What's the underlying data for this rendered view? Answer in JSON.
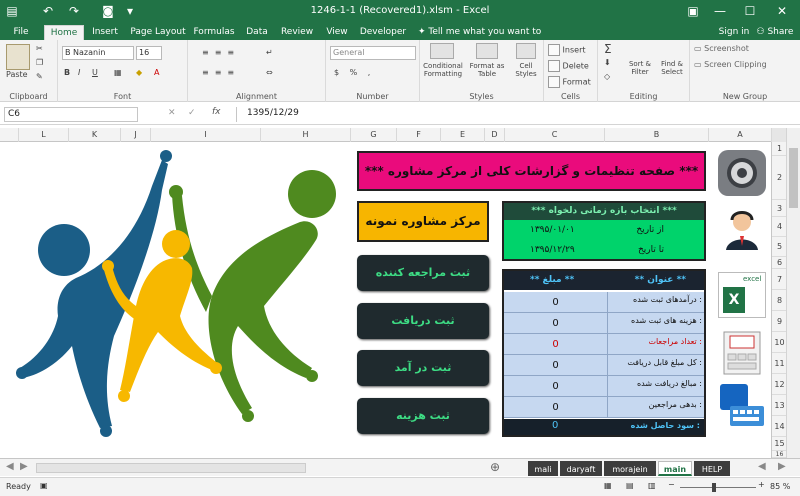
{
  "titlebar": {
    "title": "1246-1-1 (Recovered1).xlsm - Excel"
  },
  "tabs": {
    "file": "File",
    "home": "Home",
    "insert": "Insert",
    "page_layout": "Page Layout",
    "formulas": "Formulas",
    "data": "Data",
    "review": "Review",
    "view": "View",
    "developer": "Developer",
    "tell_me": "Tell me what you want to do...",
    "sign_in": "Sign in",
    "share": "Share"
  },
  "ribbon": {
    "clipboard": "Clipboard",
    "paste": "Paste",
    "font_group": "Font",
    "font_name": "B Nazanin",
    "font_size": "16",
    "alignment": "Alignment",
    "number_group": "Number",
    "number_format": "General",
    "styles": "Styles",
    "conditional": "Conditional Formatting",
    "format_table": "Format as Table",
    "cell_styles": "Cell Styles",
    "cells": "Cells",
    "insert": "Insert",
    "delete": "Delete",
    "format": "Format",
    "editing": "Editing",
    "sort": "Sort & Filter",
    "find": "Find & Select",
    "new_group": "New Group",
    "screenshot": "Screenshot",
    "screen_clipping": "Screen Clipping"
  },
  "formula_bar": {
    "name_box": "C6",
    "formula": "1395/12/29"
  },
  "columns": [
    "L",
    "K",
    "J",
    "I",
    "H",
    "G",
    "F",
    "E",
    "D",
    "C",
    "B",
    "A"
  ],
  "rows": [
    "1",
    "2",
    "3",
    "4",
    "5",
    "6",
    "7",
    "8",
    "9",
    "10",
    "11",
    "12",
    "13",
    "14",
    "15",
    "16"
  ],
  "dashboard": {
    "banner": "***  صفحه تنظیمات و گزارشات کلی از مرکز مشاوره  ***",
    "center_name": "مرکز مشاوره نمونه",
    "buttons": [
      "ثبت مراجعه کننده",
      "ثبت دریافت",
      "ثبت در آمد",
      "ثبت هزینه"
    ],
    "period": {
      "header": "***  انتخاب بازه زمانی دلخواه  ***",
      "from_label": "از تاریخ",
      "from_value": "۱۳۹۵/۰۱/۰۱",
      "to_label": "تا تاریخ",
      "to_value": "۱۳۹۵/۱۲/۲۹"
    },
    "report": {
      "hdr_title": "** عنوان **",
      "hdr_amount": "** مبلغ **",
      "rows": [
        {
          "label": "درآمدهای ثبت شده :",
          "value": "0"
        },
        {
          "label": "هزینه های ثبت شده :",
          "value": "0"
        },
        {
          "label": "تعداد مراجعات :",
          "value": "0"
        },
        {
          "label": "کل مبلغ قابل دریافت :",
          "value": "0"
        },
        {
          "label": "مبالغ دریافت شده :",
          "value": "0"
        },
        {
          "label": "بدهی مراجعین :",
          "value": "0"
        }
      ],
      "footer_label": "سود حاصل شده :",
      "footer_value": "0"
    }
  },
  "sheet_tabs": [
    "mali",
    "daryaft",
    "morajein",
    "main",
    "HELP"
  ],
  "status": {
    "ready": "Ready",
    "zoom": "85 %"
  },
  "colors": {
    "excel_green": "#217346",
    "banner_pink": "#ea0b7c",
    "gold": "#f7b500",
    "period_green": "#00d36b",
    "btn_text": "#3ddc84"
  }
}
